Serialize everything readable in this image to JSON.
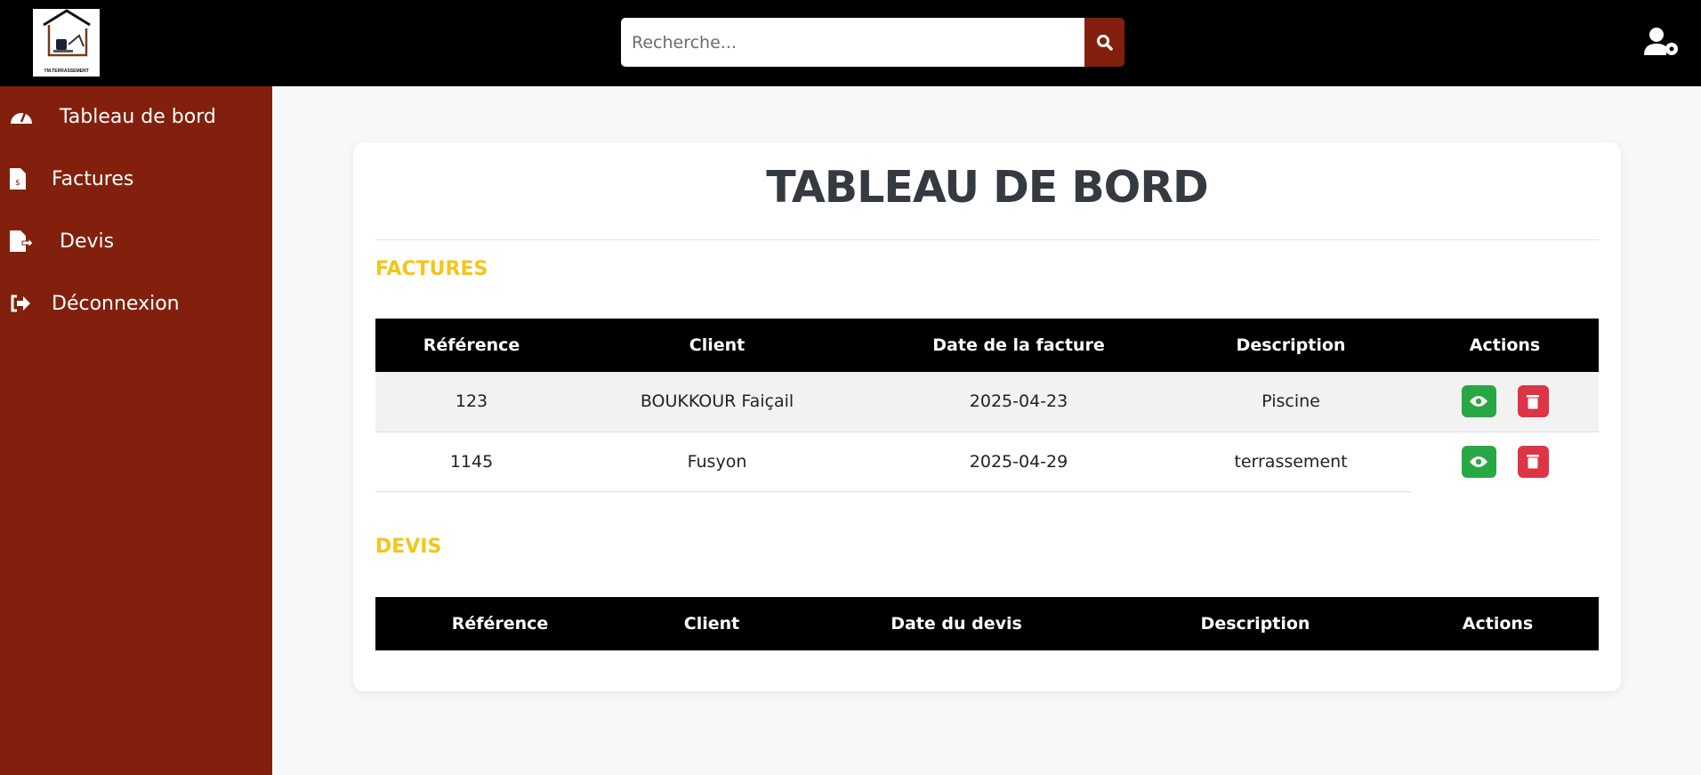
{
  "header": {
    "logo_text": "YM.TERRASSEMENT",
    "search_placeholder": "Recherche..."
  },
  "sidebar": {
    "items": [
      {
        "label": "Tableau de bord",
        "icon": "tachometer-icon"
      },
      {
        "label": "Factures",
        "icon": "invoice-icon"
      },
      {
        "label": "Devis",
        "icon": "file-export-icon"
      },
      {
        "label": "Déconnexion",
        "icon": "sign-out-icon"
      }
    ]
  },
  "main": {
    "title": "TABLEAU DE BORD",
    "factures": {
      "heading": "FACTURES",
      "columns": [
        "Référence",
        "Client",
        "Date de la facture",
        "Description",
        "Actions"
      ],
      "rows": [
        {
          "ref": "123",
          "client": "BOUKKOUR Faiçail",
          "date": "2025-04-23",
          "description": "Piscine"
        },
        {
          "ref": "1145",
          "client": "Fusyon",
          "date": "2025-04-29",
          "description": "terrassement"
        }
      ]
    },
    "devis": {
      "heading": "DEVIS",
      "columns": [
        "Référence",
        "Client",
        "Date du devis",
        "Description",
        "Actions"
      ],
      "rows": []
    }
  },
  "colors": {
    "sidebar": "#82200d",
    "accent": "#f5c518",
    "view": "#28a745",
    "delete": "#dc3545"
  }
}
